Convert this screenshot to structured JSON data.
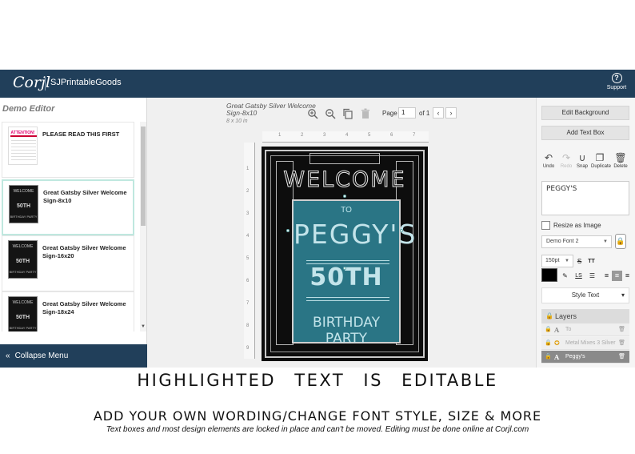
{
  "topbar": {
    "logo": "Corjl",
    "shop_name": "SJPrintableGoods",
    "support_label": "Support",
    "support_icon": "?"
  },
  "sidebar": {
    "title": "Demo Editor",
    "templates": [
      {
        "name": "PLEASE READ THIS FIRST",
        "thumb": {
          "line1": "ATTENTION!"
        }
      },
      {
        "name": "Great Gatsby Silver Welcome Sign-8x10",
        "thumb": {
          "line1": "WELCOME",
          "line2": "50TH",
          "line3": "BIRTHDAY PARTY"
        }
      },
      {
        "name": "Great Gatsby Silver Welcome Sign-16x20",
        "thumb": {
          "line1": "WELCOME",
          "line2": "50TH",
          "line3": "BIRTHDAY PARTY"
        }
      },
      {
        "name": "Great Gatsby Silver Welcome Sign-18x24",
        "thumb": {
          "line1": "WELCOME",
          "line2": "50TH",
          "line3": "BIRTHDAY PARTY"
        }
      }
    ],
    "collapse_label": "Collapse Menu"
  },
  "canvas": {
    "doc_title": "Great Gatsby Silver Welcome Sign-8x10",
    "doc_size": "8 x 10 in",
    "page_label": "Page",
    "page_value": "1",
    "page_of": "of 1",
    "ruler_top": [
      "1",
      "2",
      "3",
      "4",
      "5",
      "6",
      "7"
    ],
    "ruler_left": [
      "1",
      "2",
      "3",
      "4",
      "5",
      "6",
      "7",
      "8",
      "9"
    ],
    "sign": {
      "welcome": "WELCOME",
      "to": "TO",
      "name": "PEGGY'S",
      "number": "50TH",
      "party": "BIRTHDAY PARTY"
    }
  },
  "right": {
    "edit_background": "Edit Background",
    "add_text_box": "Add Text Box",
    "tools": {
      "undo": "Undo",
      "redo": "Redo",
      "snap": "Snap",
      "duplicate": "Duplicate",
      "delete": "Delete"
    },
    "text_value": "PEGGY'S",
    "resize_label": "Resize as Image",
    "font": "Demo Font 2",
    "size": "150pt",
    "style_text": "Style Text",
    "layers_title": "Layers",
    "layers": [
      {
        "name": "To"
      },
      {
        "name": "Metal Mixes 3 Silver"
      },
      {
        "name": "Peggy's"
      }
    ]
  },
  "captions": {
    "line1": "HIGHLIGHTED TEXT IS EDITABLE",
    "line2": "ADD YOUR OWN WORDING/CHANGE FONT STYLE, SIZE & MORE",
    "line3": "Text boxes and most design elements are locked in place and can't be moved. Editing must be done online at Corjl.com"
  }
}
